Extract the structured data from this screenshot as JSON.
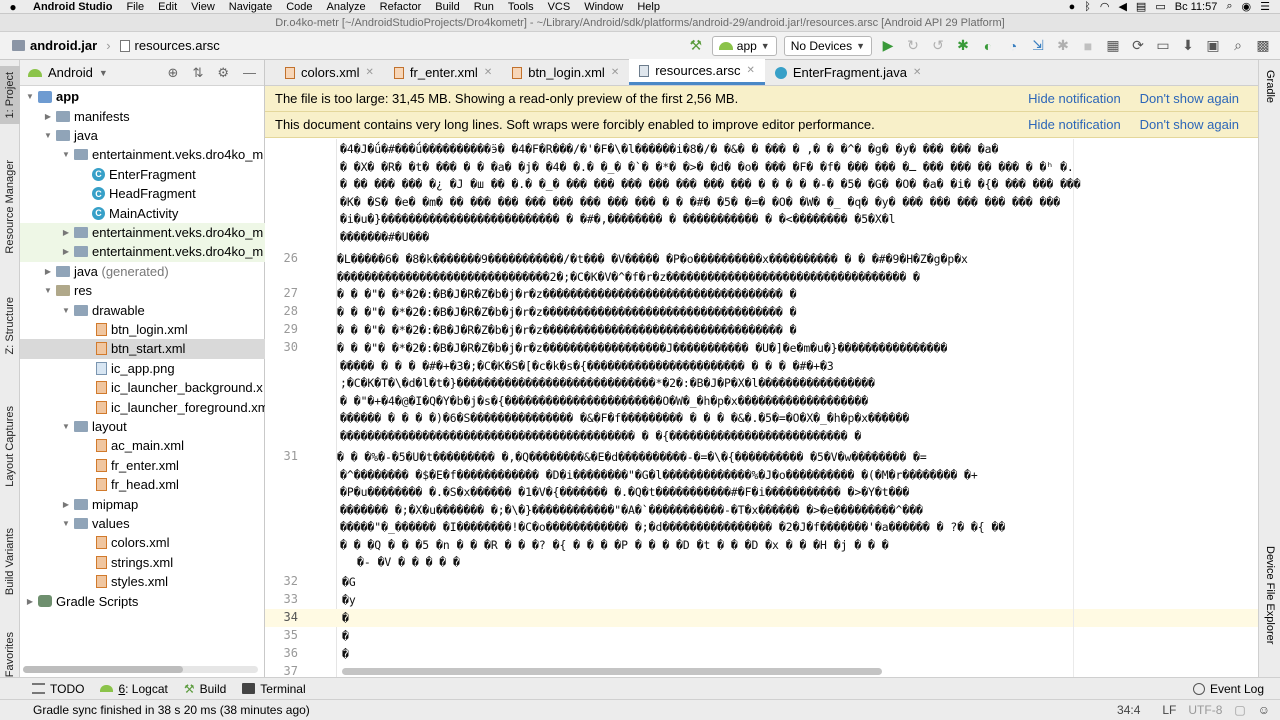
{
  "menubar": {
    "app": "Android Studio",
    "menus": [
      "File",
      "Edit",
      "View",
      "Navigate",
      "Code",
      "Analyze",
      "Refactor",
      "Build",
      "Run",
      "Tools",
      "VCS",
      "Window",
      "Help"
    ],
    "clock": "Вс 11:57"
  },
  "window": {
    "title": "Dr.o4ko-metr [~/AndroidStudioProjects/Dro4kometr] - ~/Library/Android/sdk/platforms/android-29/android.jar!/resources.arsc [Android API 29 Platform]"
  },
  "toolbar": {
    "breadcrumb_root": "android.jar",
    "breadcrumb_file": "resources.arsc",
    "run_config": "app",
    "device": "No Devices"
  },
  "left_strip": {
    "project": "1: Project",
    "resource_manager": "Resource Manager",
    "structure": "Z: Structure",
    "layout_captures": "Layout Captures",
    "build_variants": "Build Variants",
    "favorites": "Favorites"
  },
  "project_panel": {
    "view_mode": "Android",
    "tree": [
      {
        "label": "app",
        "bold": true
      },
      {
        "label": "manifests"
      },
      {
        "label": "java"
      },
      {
        "label": "entertainment.veks.dro4ko_m"
      },
      {
        "label": "EnterFragment"
      },
      {
        "label": "HeadFragment"
      },
      {
        "label": "MainActivity"
      },
      {
        "label": "entertainment.veks.dro4ko_m"
      },
      {
        "label": "entertainment.veks.dro4ko_m"
      },
      {
        "label": "java",
        "suffix": "(generated)"
      },
      {
        "label": "res"
      },
      {
        "label": "drawable"
      },
      {
        "label": "btn_login.xml"
      },
      {
        "label": "btn_start.xml"
      },
      {
        "label": "ic_app.png"
      },
      {
        "label": "ic_launcher_background.x"
      },
      {
        "label": "ic_launcher_foreground.xm"
      },
      {
        "label": "layout"
      },
      {
        "label": "ac_main.xml"
      },
      {
        "label": "fr_enter.xml"
      },
      {
        "label": "fr_head.xml"
      },
      {
        "label": "mipmap"
      },
      {
        "label": "values"
      },
      {
        "label": "colors.xml"
      },
      {
        "label": "strings.xml"
      },
      {
        "label": "styles.xml"
      },
      {
        "label": "Gradle Scripts"
      }
    ]
  },
  "editor": {
    "tabs": [
      "colors.xml",
      "fr_enter.xml",
      "btn_login.xml",
      "resources.arsc",
      "EnterFragment.java"
    ],
    "notifications": [
      {
        "text": "The file is too large: 31,45 MB. Showing a read-only preview of the first 2,56 MB.",
        "action1": "Hide notification",
        "action2": "Don't show again"
      },
      {
        "text": "This document contains very long lines. Soft wraps were forcibly enabled to improve editor performance.",
        "action1": "Hide notification",
        "action2": "Don't show again"
      }
    ],
    "line_numbers": [
      "26",
      "27",
      "28",
      "29",
      "30",
      "31",
      "32",
      "33",
      "34",
      "35",
      "36",
      "37"
    ],
    "code_lines": [
      "�4�J�ǘ�#���ǘ����������ӭ� �4�F�R���/�'�F�\\�l������i�8�/� �&� � ��� � ,� � �^� �g� �y� ��� ��� �a�",
      "� �X� �R� �t� ��� � � �a� �j� �4� �.� �_� �`� �*� �>� �d� �o� ��� �F� �f� ��� ��� �ـ ��� ��� �� ��� � �ʰ �.",
      "� �� ��� ��� �¿ �J �ш �� �.� �_� ��� ��� ��� ��� ��� ��� ��� � � � � �-� �5� �G� �O� �a� �i� �{� ��� ��� ���",
      " �K� �S� �e� �m� �� ��� ��� ��� ��� ��� ��� ��� � � �#� �5� �=� �O� �W� �_ �q� �y� ��� ��� ��� ��� ��� ���",
      "�i�u�}�������������������������� � �#�,�������� � ����������� � �<�������� �5�X�l",
      "�������#�U���",
      "�L�����6� �8�k�������9�����������/�t��� �V����� �P�o����������x���������� � � �#�9�H�Z�g�p�x",
      "�������������������������������2�;�C�K�V�^�f�r�z����������������������������������� �",
      "� � �\"� �*�2�:�B�J�R�Z�b�j�r�z����������������������������������� �",
      "� � �\"� �*�2�:�B�J�R�Z�b�j�r�z����������������������������������� �",
      "� � �\"� �*�2�:�B�J�R�Z�b�j�r�z����������������������������������� �",
      "� � �\"� �*�2�:�B�J�R�Z�b�j�r�z������������������J����������� �U�]�e�m�u�}����������������",
      "����� � � � �#�+�3�;�C�K�S�[�c�k�s�{����������������������� � � � �#�+�3",
      ";�C�K�T�\\�d�l�t�}�����������������������������*�2�:�B�J�P�X�l�����������������",
      " � �\"�+�4�@�I�Q�Y�b�j�s�{�����������������������O�W�_�h�p�x�������������������",
      "������ � � � �)�6�S��������������� �&�F�f��������� � � � �&�.�5�=�O�X�_�h�p�x������",
      "������������������������������������������� � �{�������������������������� �",
      "� � �%�-�5�U�t��������� �,�Q��������&�E�d����������-�=�\\�{���������� �5�V�w�������� �=",
      "�^�������� �$�E�f������������ �D�i��������\"�G�l�������������%�J�o���������� �(�M�r�������� �+",
      "�P�u�������� �.�S�x������ �1�V�{������� �.�Q�t�����������#�F�i����������� �>�Y�t���",
      "������� �;�X�u������� �;�\\�}������������\"�A�`�����������-�T�x������ �>�e���������^���",
      "�����\"�_������ �I��������!�C�o������������ �;�d���������������� �2�J�f�������'�a������ � ?� �{ ��",
      "� � �Q � � �5 �n � � �R � � �? �{ � � � �P � � � �D �t � � �D �x � � �H �j � � �",
      "  �- �V  �  �  �  �  �",
      "�G",
      "�y",
      "�",
      "�",
      "�",
      ""
    ]
  },
  "right_strip": {
    "gradle": "Gradle",
    "device_explorer": "Device File Explorer"
  },
  "bottom_tools": {
    "todo": "TODO",
    "logcat_num": "6",
    "logcat": ": Logcat",
    "build": "Build",
    "terminal": "Terminal",
    "event_log": "Event Log"
  },
  "status": {
    "message": "Gradle sync finished in 38 s 20 ms (38 minutes ago)",
    "position": "34:4",
    "line_sep": "LF",
    "encoding": "UTF-8"
  }
}
